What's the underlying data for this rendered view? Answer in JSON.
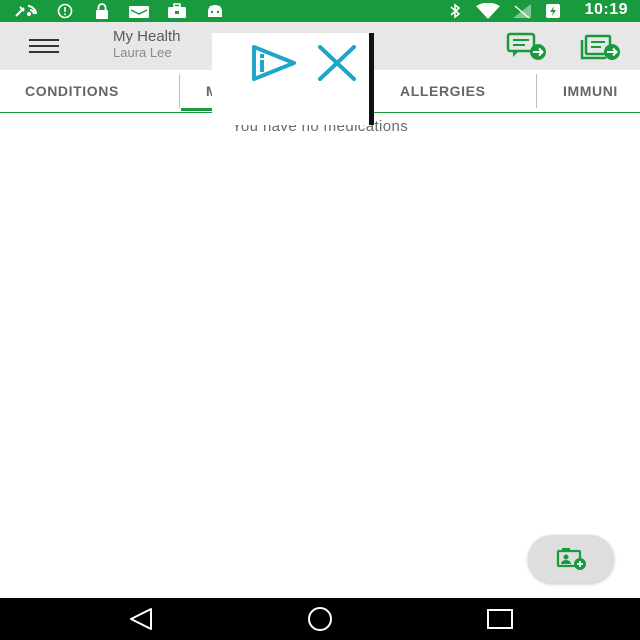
{
  "status_bar": {
    "time": "10:19",
    "left_icons": [
      "wrench-satellite-icon",
      "info-circle-icon",
      "lock-icon",
      "mail-tray-icon",
      "briefcase-icon",
      "android-icon"
    ],
    "right_icons": [
      "bluetooth-icon",
      "wifi-icon",
      "no-signal-icon",
      "battery-charging-icon"
    ]
  },
  "app_bar": {
    "title": "My Health",
    "subtitle": "Laura Lee",
    "actions": [
      "send-message-icon",
      "send-record-icon"
    ]
  },
  "tabs": {
    "items": [
      {
        "label": "CONDITIONS"
      },
      {
        "label": "M"
      },
      {
        "label": "ALLERGIES"
      },
      {
        "label": "IMMUNI"
      }
    ],
    "active_index": 1
  },
  "main": {
    "empty_message": "You have no medications"
  },
  "overlay": {
    "icons": [
      "adchoices-icon",
      "close-icon"
    ]
  },
  "fab": {
    "icon": "add-record-icon"
  },
  "nav": {
    "buttons": [
      "back-icon",
      "home-icon",
      "recents-icon"
    ]
  },
  "colors": {
    "accent": "#1a9a3e",
    "app_bar_bg": "#e7e7e7",
    "overlay_icon": "#1fa5c8",
    "nav_bg": "#000000"
  }
}
